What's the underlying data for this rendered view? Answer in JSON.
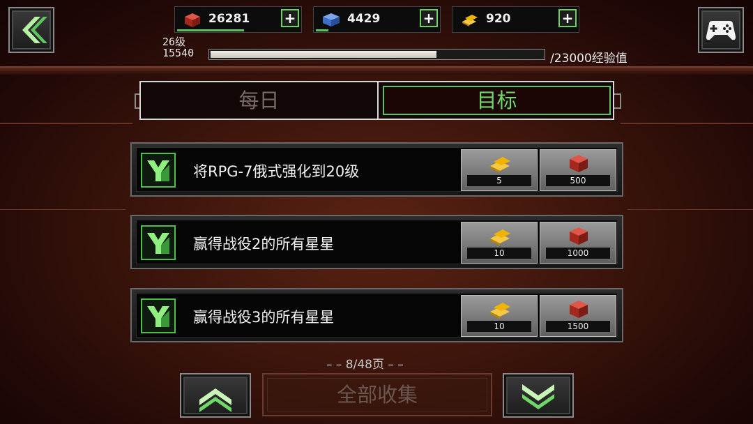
{
  "header": {
    "resources": [
      {
        "name": "red-crate",
        "value": "26281",
        "color": "#c0392b",
        "bar_fraction": 0.55
      },
      {
        "name": "blue-crate",
        "value": "4429",
        "color": "#3d6ec9",
        "bar_fraction": 0.1
      },
      {
        "name": "gold-bars",
        "value": "920",
        "color": "#f0b400",
        "bar_fraction": 0
      }
    ],
    "plus_label": "+",
    "level_label": "26级",
    "xp_current": "15540",
    "xp_max_label": "/23000经验值",
    "xp_fraction": 0.676
  },
  "tabs": {
    "daily": "每日",
    "goals": "目标",
    "active": "goals"
  },
  "quests": [
    {
      "title": "将RPG-7俄式强化到20级",
      "reward_gold": "5",
      "reward_crate": "500"
    },
    {
      "title": "赢得战役2的所有星星",
      "reward_gold": "10",
      "reward_crate": "1000"
    },
    {
      "title": "赢得战役3的所有星星",
      "reward_gold": "10",
      "reward_crate": "1500"
    }
  ],
  "footer": {
    "page_label": "– – 8/48页 – –",
    "collect_all": "全部收集"
  },
  "colors": {
    "accent_green": "#5fc35f",
    "gold": "#f0b400",
    "crate_red": "#c0392b"
  },
  "icons": [
    "back-chevrons-icon",
    "gamepad-icon",
    "quest-emblem-icon",
    "up-chevron-icon",
    "down-chevron-icon"
  ]
}
